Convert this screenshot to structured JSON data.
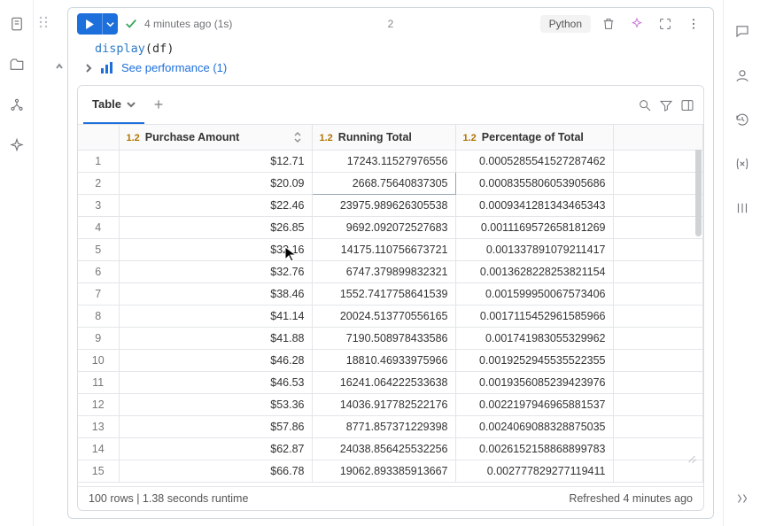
{
  "header": {
    "timestamp": "4 minutes ago (1s)",
    "exec_count": "2",
    "language": "Python"
  },
  "code": {
    "fn": "display",
    "arg": "df"
  },
  "perf": {
    "label": "See performance (1)"
  },
  "tab": {
    "label": "Table"
  },
  "columns": {
    "c1": "Purchase Amount",
    "c2": "Running Total",
    "c3": "Percentage of Total",
    "type": "1.2"
  },
  "rows": [
    {
      "n": "1",
      "a": "$12.71",
      "b": "17243.11527976556",
      "c": "0.0005285541527287462"
    },
    {
      "n": "2",
      "a": "$20.09",
      "b": "2668.75640837305",
      "c": "0.0008355806053905686"
    },
    {
      "n": "3",
      "a": "$22.46",
      "b": "23975.989626305538",
      "c": "0.0009341281343465343"
    },
    {
      "n": "4",
      "a": "$26.85",
      "b": "9692.092072527683",
      "c": "0.0011169572658181269"
    },
    {
      "n": "5",
      "a": "$32.16",
      "b": "14175.110756673721",
      "c": "0.001337891079211417"
    },
    {
      "n": "6",
      "a": "$32.76",
      "b": "6747.379899832321",
      "c": "0.0013628228253821154"
    },
    {
      "n": "7",
      "a": "$38.46",
      "b": "1552.7417758641539",
      "c": "0.001599950067573406"
    },
    {
      "n": "8",
      "a": "$41.14",
      "b": "20024.513770556165",
      "c": "0.0017115452961585966"
    },
    {
      "n": "9",
      "a": "$41.88",
      "b": "7190.508978433586",
      "c": "0.001741983055329962"
    },
    {
      "n": "10",
      "a": "$46.28",
      "b": "18810.46933975966",
      "c": "0.0019252945535522355"
    },
    {
      "n": "11",
      "a": "$46.53",
      "b": "16241.064222533638",
      "c": "0.0019356085239423976"
    },
    {
      "n": "12",
      "a": "$53.36",
      "b": "14036.917782522176",
      "c": "0.0022197946965881537"
    },
    {
      "n": "13",
      "a": "$57.86",
      "b": "8771.857371229398",
      "c": "0.0024069088328875035"
    },
    {
      "n": "14",
      "a": "$62.87",
      "b": "24038.856425532256",
      "c": "0.0026152158868899783"
    },
    {
      "n": "15",
      "a": "$66.78",
      "b": "19062.893385913667",
      "c": "0.002777829277119411"
    }
  ],
  "status": {
    "left": "100 rows  |  1.38 seconds runtime",
    "right": "Refreshed 4 minutes ago"
  }
}
